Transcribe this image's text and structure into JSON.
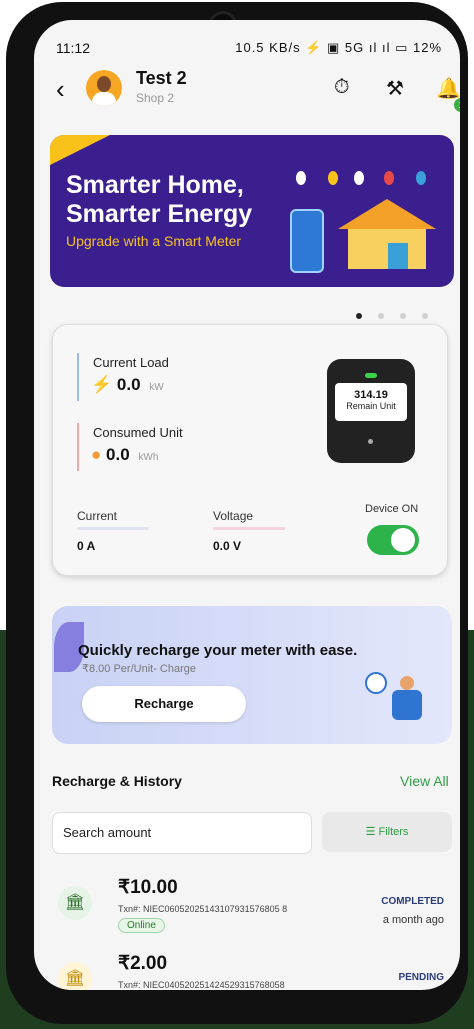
{
  "status_bar": {
    "time": "11:12",
    "system": "10.5 KB/s ⚡ ▣ 5G ıl ıl ▭ 12%"
  },
  "header": {
    "name": "Test 2",
    "shop": "Shop 2",
    "notification_count": "1"
  },
  "banner": {
    "line1": "Smarter Home,",
    "line2": "Smarter Energy",
    "tagline": "Upgrade with a Smart Meter",
    "slide_count": 4,
    "active_slide": 1
  },
  "meter": {
    "current_load_label": "Current Load",
    "current_load_value": "0.0",
    "current_load_unit": "kW",
    "consumed_label": "Consumed Unit",
    "consumed_value": "0.0",
    "consumed_unit": "kWh",
    "display_value": "314.19",
    "display_label": "Remain Unit",
    "current_label": "Current",
    "current_value": "0 A",
    "voltage_label": "Voltage",
    "voltage_value": "0.0 V",
    "device_label": "Device ON",
    "device_on": true
  },
  "promo": {
    "title": "Quickly recharge your meter with ease.",
    "subtitle": "₹8.00 Per/Unit- Charge",
    "button": "Recharge"
  },
  "history": {
    "title": "Recharge & History",
    "view_all": "View All",
    "search_placeholder": "Search amount",
    "filters": "Filters",
    "items": [
      {
        "amount": "₹10.00",
        "txn": "Txn#: NIEC06052025143107931576805 8",
        "mode": "Online",
        "status": "COMPLETED",
        "time": "a month ago"
      },
      {
        "amount": "₹2.00",
        "txn": "Txn#: NIEC040520251424529315768058",
        "status": "PENDING"
      }
    ]
  },
  "colors": {
    "accent_green": "#2e9e44",
    "banner_purple": "#3b1f8f",
    "banner_yellow": "#f8c21a"
  }
}
